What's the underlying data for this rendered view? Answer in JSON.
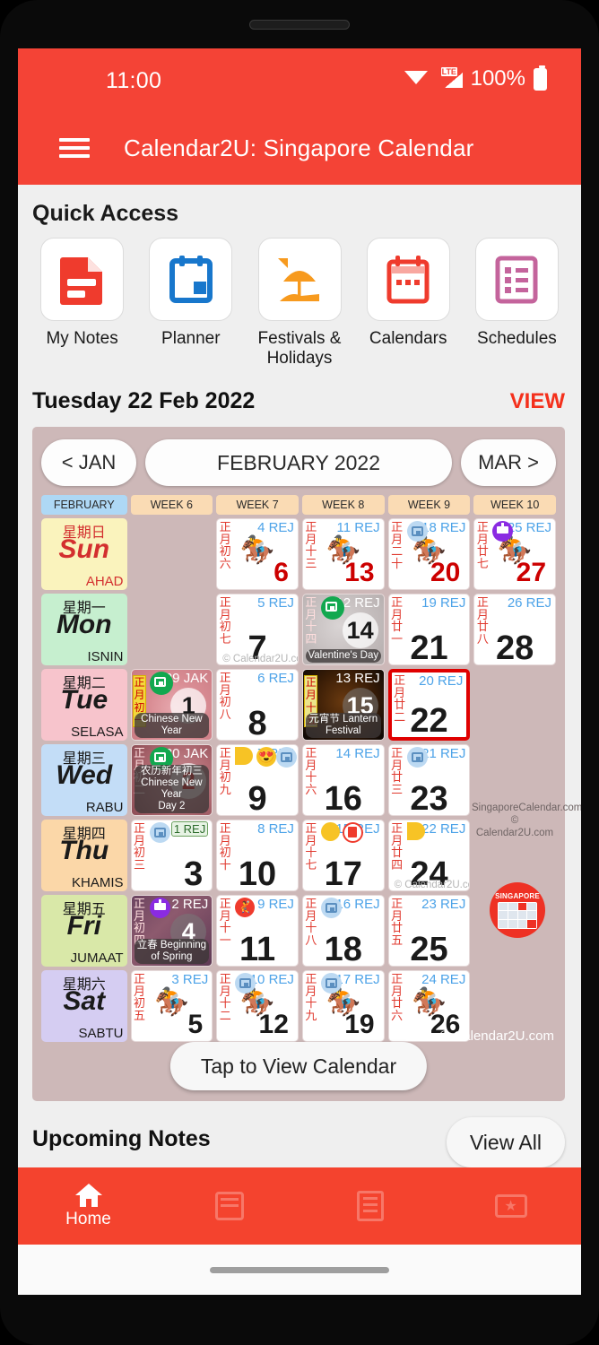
{
  "status_bar": {
    "time": "11:00",
    "network": "LTE",
    "battery_pct": "100%"
  },
  "app_bar": {
    "title": "Calendar2U: Singapore Calendar",
    "menu_icon": "hamburger-icon"
  },
  "quick_access": {
    "title": "Quick Access",
    "items": [
      {
        "label": "My Notes",
        "icon": "notes-icon",
        "color": "#ef3b2d"
      },
      {
        "label": "Planner",
        "icon": "planner-icon",
        "color": "#1877cc"
      },
      {
        "label": "Festivals & Holidays",
        "icon": "umbrella-icon",
        "color": "#f79a1e"
      },
      {
        "label": "Calendars",
        "icon": "calendar-icon",
        "color": "#ef3b2d"
      },
      {
        "label": "Schedules",
        "icon": "schedule-icon",
        "color": "#c4649c"
      }
    ]
  },
  "date_header": {
    "date_text": "Tuesday 22 Feb 2022",
    "view_label": "VIEW"
  },
  "calendar": {
    "prev_label": "< JAN",
    "month_label": "FEBRUARY 2022",
    "next_label": "MAR >",
    "column_headers": [
      "FEBRUARY",
      "WEEK 6",
      "WEEK 7",
      "WEEK 8",
      "WEEK 9",
      "WEEK 10"
    ],
    "day_rows": [
      {
        "cn": "星期日",
        "en": "Sun",
        "ms": "AHAD",
        "bg": "#faf3bd",
        "fg": "#d32f2f"
      },
      {
        "cn": "星期一",
        "en": "Mon",
        "ms": "ISNIN",
        "bg": "#c6efcf",
        "fg": "#1a1a1a"
      },
      {
        "cn": "星期二",
        "en": "Tue",
        "ms": "SELASA",
        "bg": "#f7c4cc",
        "fg": "#1a1a1a"
      },
      {
        "cn": "星期三",
        "en": "Wed",
        "ms": "RABU",
        "bg": "#c3ddf7",
        "fg": "#1a1a1a"
      },
      {
        "cn": "星期四",
        "en": "Thu",
        "ms": "KHAMIS",
        "bg": "#fbd7a8",
        "fg": "#1a1a1a"
      },
      {
        "cn": "星期五",
        "en": "Fri",
        "ms": "JUMAAT",
        "bg": "#d9e8a8",
        "fg": "#1a1a1a"
      },
      {
        "cn": "星期六",
        "en": "Sat",
        "ms": "SABTU",
        "bg": "#d5cdf2",
        "fg": "#1a1a1a"
      }
    ],
    "weeks": [
      {
        "name": "WEEK 6",
        "cells": [
          {
            "empty": true
          },
          {
            "empty": true
          },
          {
            "day": "1",
            "lunar": "正月初一",
            "alt": "29 JAK",
            "festival": "Chinese New Year",
            "theme": "cny1",
            "day_style": "chip",
            "badges": [
              "calendar-green-icon"
            ],
            "couplet": "正月初一"
          },
          {
            "day": "2",
            "lunar": "正月初二",
            "alt": "30 JAK",
            "festival": "农历新年初三\nChinese New Year\nDay 2",
            "theme": "cny2",
            "day_style": "red-chip",
            "badges": [
              "calendar-green-icon"
            ]
          },
          {
            "day": "3",
            "lunar": "正月初三",
            "alt": "1 REJ",
            "alt_boxed": true,
            "badges": [
              "calendar-blue-icon"
            ]
          },
          {
            "day": "4",
            "lunar": "正月初四",
            "alt": "2 REJ",
            "festival": "立春 Beginning of Spring",
            "theme": "spring",
            "day_style": "chip-white",
            "badges": [
              "cake-purple-icon"
            ]
          },
          {
            "day": "5",
            "lunar": "正月初五",
            "alt": "3 REJ",
            "horse": true
          }
        ]
      },
      {
        "name": "WEEK 7",
        "cells": [
          {
            "day": "6",
            "lunar": "正月初六",
            "alt": "4 REJ",
            "horse": true,
            "day_red": true
          },
          {
            "day": "7",
            "lunar": "正月初七",
            "alt": "5 REJ",
            "watermark": "© Calendar2U.com",
            "day_center": true
          },
          {
            "day": "8",
            "lunar": "正月初八",
            "alt": "6 REJ",
            "day_center": true
          },
          {
            "day": "9",
            "lunar": "正月初九",
            "alt": "7 REJ",
            "day_center": true,
            "badges": [
              "moon-half-icon",
              "heart-eyes-icon",
              "calendar-blue-icon"
            ]
          },
          {
            "day": "10",
            "lunar": "正月初十",
            "alt": "8 REJ",
            "day_center": true
          },
          {
            "day": "11",
            "lunar": "正月十一",
            "alt": "9 REJ",
            "day_center": true,
            "badges": [
              "person-red-icon"
            ]
          },
          {
            "day": "12",
            "lunar": "正月十二",
            "alt": "10 REJ",
            "horse": true,
            "badges": [
              "calendar-blue-icon"
            ]
          }
        ]
      },
      {
        "name": "WEEK 8",
        "cells": [
          {
            "day": "13",
            "lunar": "正月十三",
            "alt": "11 REJ",
            "horse": true,
            "day_red": true
          },
          {
            "day": "14",
            "lunar": "正月十四",
            "alt": "12 REJ",
            "festival": "Valentine's Day",
            "theme": "val",
            "day_style": "chip",
            "badges": [
              "calendar-green-icon"
            ]
          },
          {
            "day": "15",
            "lunar": "正月十五",
            "alt": "13 REJ",
            "festival": "元宵节 Lantern Festival",
            "theme": "lantern",
            "day_style": "chip-white",
            "couplet": "正月十五",
            "couplet_color": "gold"
          },
          {
            "day": "16",
            "lunar": "正月十六",
            "alt": "14 REJ",
            "day_center": true
          },
          {
            "day": "17",
            "lunar": "正月十七",
            "alt": "15 REJ",
            "day_center": true,
            "badges": [
              "moon-full-icon",
              "notes-red-icon"
            ]
          },
          {
            "day": "18",
            "lunar": "正月十八",
            "alt": "16 REJ",
            "day_center": true,
            "badges": [
              "calendar-blue-icon"
            ]
          },
          {
            "day": "19",
            "lunar": "正月十九",
            "alt": "17 REJ",
            "horse": true,
            "badges": [
              "calendar-blue-icon"
            ]
          }
        ]
      },
      {
        "name": "WEEK 9",
        "cells": [
          {
            "day": "20",
            "lunar": "正月二十",
            "alt": "18 REJ",
            "horse": true,
            "day_red": true,
            "badges": [
              "calendar-blue-icon"
            ]
          },
          {
            "day": "21",
            "lunar": "正月廿一",
            "alt": "19 REJ",
            "day_center": true
          },
          {
            "day": "22",
            "lunar": "正月廿二",
            "alt": "20 REJ",
            "day_center": true,
            "today": true
          },
          {
            "day": "23",
            "lunar": "正月廿三",
            "alt": "21 REJ",
            "day_center": true,
            "badges": [
              "calendar-blue-icon"
            ]
          },
          {
            "day": "24",
            "lunar": "正月廿四",
            "alt": "22 REJ",
            "day_center": true,
            "watermark": "© Calendar2U.com",
            "badges": [
              "moon-half-icon"
            ]
          },
          {
            "day": "25",
            "lunar": "正月廿五",
            "alt": "23 REJ",
            "day_center": true
          },
          {
            "day": "26",
            "lunar": "正月廿六",
            "alt": "24 REJ",
            "horse": true
          }
        ]
      },
      {
        "name": "WEEK 10",
        "cells": [
          {
            "day": "27",
            "lunar": "正月廿七",
            "alt": "25 REJ",
            "horse": true,
            "day_red": true,
            "badges": [
              "cake-purple-icon"
            ]
          },
          {
            "day": "28",
            "lunar": "正月廿八",
            "alt": "26 REJ",
            "day_center": true
          },
          {
            "empty": true
          },
          {
            "empty": true
          },
          {
            "empty": true
          },
          {
            "empty": true
          },
          {
            "empty": true
          }
        ]
      }
    ],
    "side_text": "SingaporeCalendar.com\n© Calendar2U.com",
    "logo_text": "SINGAPORE",
    "card_watermark": "© Calendar2U.com",
    "tap_label": "Tap to View Calendar"
  },
  "upcoming": {
    "title": "Upcoming Notes",
    "view_all": "View All"
  },
  "bottom_nav": {
    "items": [
      {
        "label": "Home",
        "icon": "home-icon",
        "active": true
      },
      {
        "label": "",
        "icon": "calendar-icon",
        "active": false
      },
      {
        "label": "",
        "icon": "list-icon",
        "active": false
      },
      {
        "label": "",
        "icon": "ticket-icon",
        "active": false
      }
    ]
  },
  "colors": {
    "brand_red": "#f44336",
    "card_bg": "#cdb8b8",
    "accent_blue": "#4da3e8",
    "lunar_red": "#e03a2f"
  }
}
